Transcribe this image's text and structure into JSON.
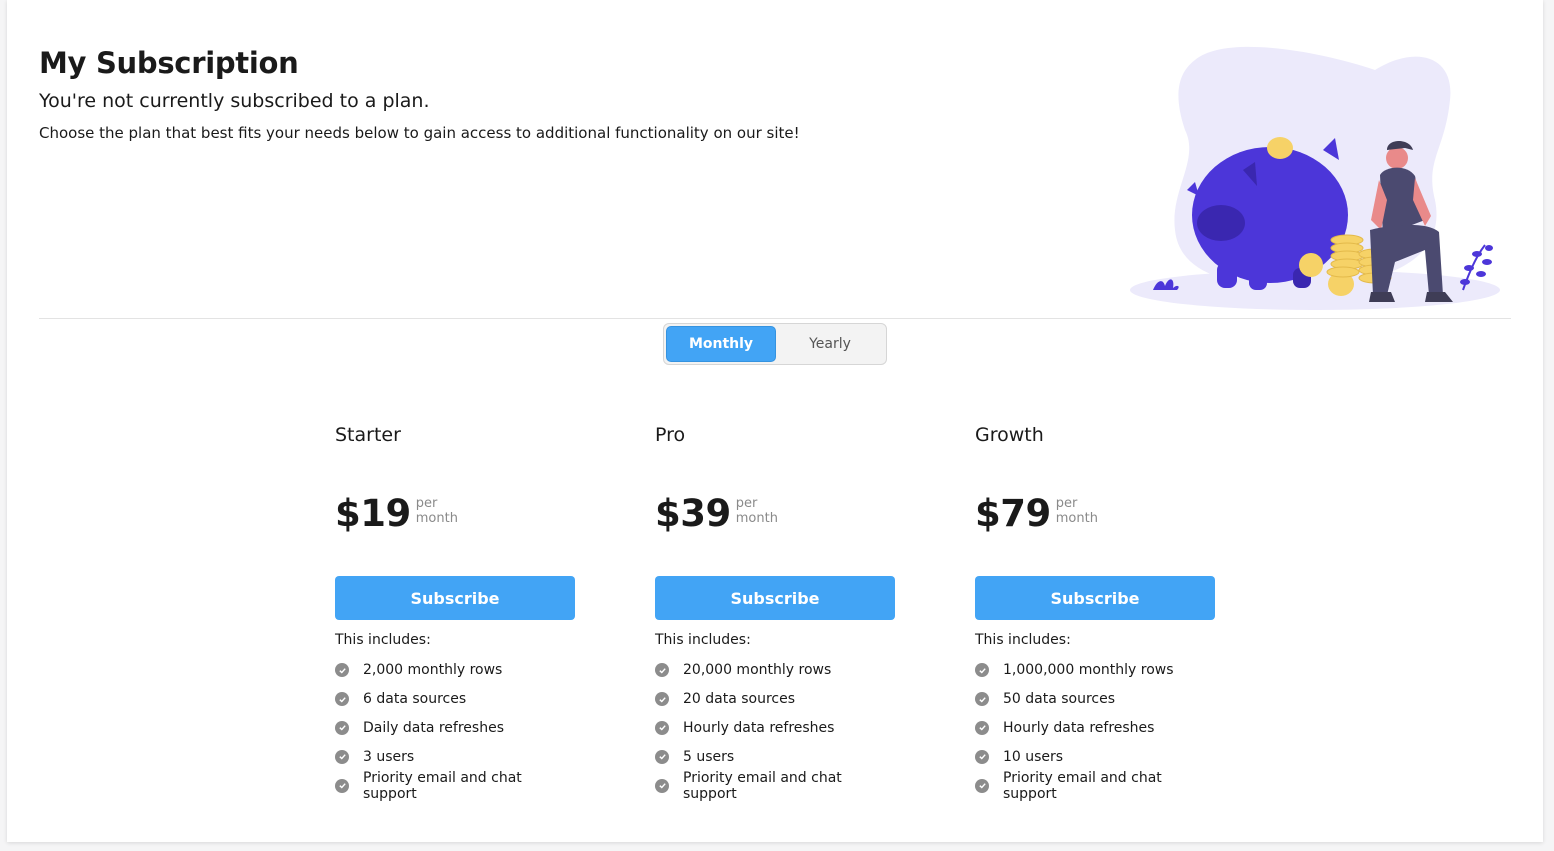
{
  "header": {
    "title": "My Subscription",
    "subtitle": "You're not currently subscribed to a plan.",
    "description": "Choose the plan that best fits your needs below to gain access to additional functionality on our site!"
  },
  "billing_toggle": {
    "monthly_label": "Monthly",
    "yearly_label": "Yearly",
    "selected": "Monthly"
  },
  "plans": [
    {
      "name": "Starter",
      "price": "$19",
      "per_1": "per",
      "per_2": "month",
      "button": "Subscribe",
      "includes_label": "This includes:",
      "features": [
        "2,000 monthly rows",
        "6 data sources",
        "Daily data refreshes",
        "3 users",
        "Priority email and chat support"
      ]
    },
    {
      "name": "Pro",
      "price": "$39",
      "per_1": "per",
      "per_2": "month",
      "button": "Subscribe",
      "includes_label": "This includes:",
      "features": [
        "20,000 monthly rows",
        "20 data sources",
        "Hourly data refreshes",
        "5 users",
        "Priority email and chat support"
      ]
    },
    {
      "name": "Growth",
      "price": "$79",
      "per_1": "per",
      "per_2": "month",
      "button": "Subscribe",
      "includes_label": "This includes:",
      "features": [
        "1,000,000 monthly rows",
        "50 data sources",
        "Hourly data refreshes",
        "10 users",
        "Priority email and chat support"
      ]
    }
  ],
  "colors": {
    "accent": "#42a4f5",
    "illustration_primary": "#4c36d9",
    "illustration_blob": "#eceafb",
    "coin": "#f6d267",
    "check_icon": "#8c8c8c"
  },
  "icons": {
    "feature_check": "check-circle-icon",
    "illustration": "piggy-bank-illustration"
  }
}
